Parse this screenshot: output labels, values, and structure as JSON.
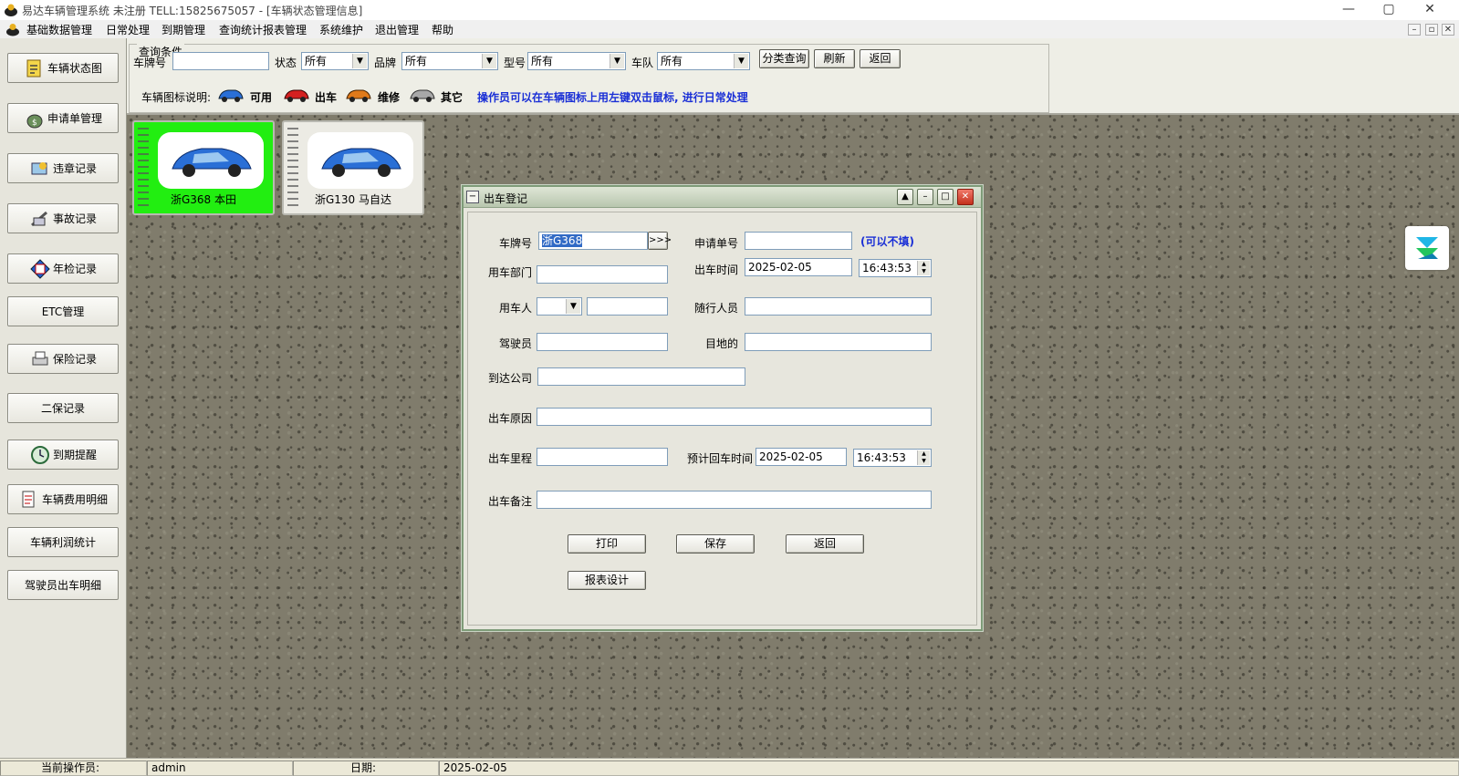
{
  "window": {
    "title": "易达车辆管理系统 未注册 TELL:15825675057 - [车辆状态管理信息]",
    "controls": {
      "minimize": "—",
      "maximize": "▢",
      "close": "✕"
    }
  },
  "menu": {
    "items": [
      "基础数据管理",
      "日常处理",
      "到期管理",
      "查询统计报表管理",
      "系统维护",
      "退出管理",
      "帮助"
    ],
    "mdi": {
      "minimize": "–",
      "restore": "▫",
      "close": "✕"
    }
  },
  "sidebar": {
    "buttons": [
      {
        "label": "车辆状态图",
        "icon": "car-status-icon"
      },
      {
        "label": "申请单管理",
        "icon": "money-bag-icon"
      },
      {
        "label": "违章记录",
        "icon": "violation-icon"
      },
      {
        "label": "事故记录",
        "icon": "accident-icon"
      },
      {
        "label": "年检记录",
        "icon": "inspection-icon"
      },
      {
        "label": "ETC管理",
        "icon": ""
      },
      {
        "label": "保险记录",
        "icon": "printer-icon"
      },
      {
        "label": "二保记录",
        "icon": ""
      },
      {
        "label": "到期提醒",
        "icon": "clock-icon"
      },
      {
        "label": "车辆费用明细",
        "icon": "document-icon"
      },
      {
        "label": "车辆利润统计",
        "icon": ""
      },
      {
        "label": "驾驶员出车明细",
        "icon": ""
      }
    ]
  },
  "query": {
    "legend": "查询条件",
    "plate_label": "车牌号",
    "plate_value": "",
    "status_label": "状态",
    "status_value": "所有",
    "brand_label": "品牌",
    "brand_value": "所有",
    "model_label": "型号",
    "model_value": "所有",
    "fleet_label": "车队",
    "fleet_value": "所有",
    "btn_classify": "分类查询",
    "btn_refresh": "刷新",
    "btn_back": "返回",
    "icon_legend_label": "车辆图标说明:",
    "legend_available": "可用",
    "legend_out": "出车",
    "legend_repair": "维修",
    "legend_other": "其它",
    "hint": "操作员可以在车辆图标上用左键双击鼠标, 进行日常处理",
    "colors": {
      "available": "#2a6fd6",
      "out": "#d42020",
      "repair": "#e07a1a",
      "other": "#a0a0a0",
      "hint": "#1a2fd6"
    }
  },
  "cars": [
    {
      "caption": "浙G368 本田",
      "state": "selected",
      "color": "#22ee11"
    },
    {
      "caption": "浙G130 马自达",
      "state": "normal",
      "color": "#ecebe4"
    }
  ],
  "dialog": {
    "title": "出车登记",
    "plate_label": "车牌号",
    "plate_value": "浙G368",
    "plate_btn": ">>>",
    "request_label": "申请单号",
    "request_value": "",
    "request_hint": "(可以不填)",
    "dept_label": "用车部门",
    "dept_value": "",
    "out_time_label": "出车时间",
    "out_date": "2025-02-05",
    "out_time": "16:43:53",
    "user_label": "用车人",
    "user_combo": "",
    "user_value": "",
    "companion_label": "随行人员",
    "companion_value": "",
    "driver_label": "驾驶员",
    "driver_value": "",
    "destination_label": "目地的",
    "destination_value": "",
    "company_label": "到达公司",
    "company_value": "",
    "reason_label": "出车原因",
    "reason_value": "",
    "mileage_label": "出车里程",
    "mileage_value": "",
    "return_label": "预计回车时间",
    "return_date": "2025-02-05",
    "return_time": "16:43:53",
    "remark_label": "出车备注",
    "remark_value": "",
    "btn_print": "打印",
    "btn_save": "保存",
    "btn_back": "返回",
    "btn_report": "报表设计",
    "controls": {
      "scroll_up": "▲",
      "minimize": "–",
      "maximize": "□",
      "close": "✕"
    }
  },
  "statusbar": {
    "operator_label": "当前操作员:",
    "operator_value": "admin",
    "date_label": "日期:",
    "date_value": "2025-02-05"
  }
}
